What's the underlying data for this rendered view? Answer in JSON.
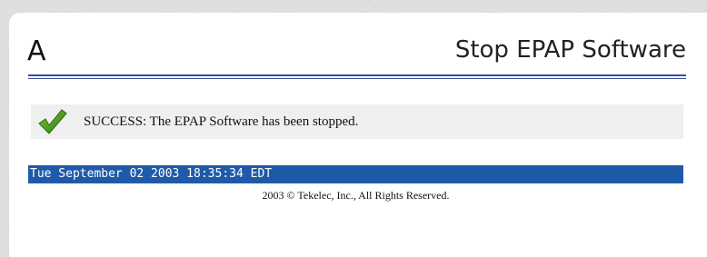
{
  "header": {
    "logo_text": "A",
    "title": "Stop EPAP Software"
  },
  "message": {
    "icon": "check-icon",
    "text": "SUCCESS: The EPAP Software has been stopped."
  },
  "status": {
    "timestamp": "Tue September 02 2003 18:35:34 EDT"
  },
  "footer": {
    "copyright": "2003 © Tekelec, Inc., All Rights Reserved."
  },
  "colors": {
    "rule": "#3a4d9b",
    "status_bar": "#1f5aa8",
    "message_bg": "#efefef",
    "check": "#4a9a21"
  }
}
